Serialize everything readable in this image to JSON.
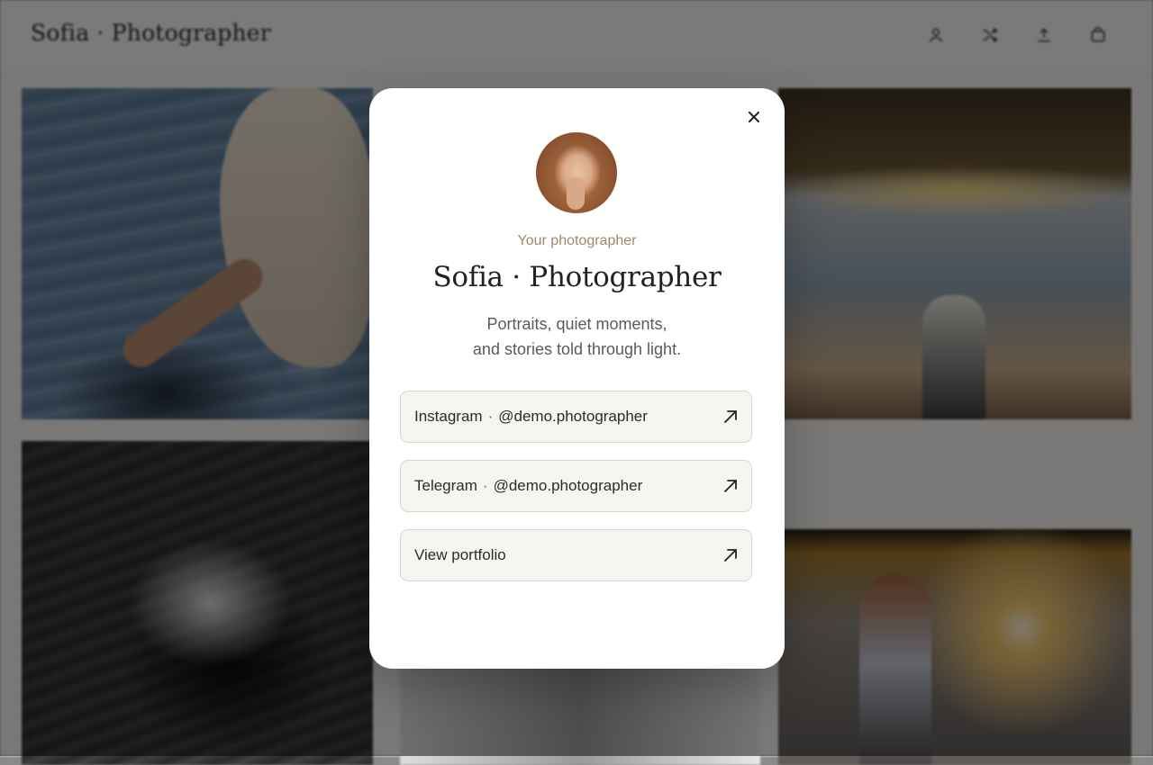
{
  "header": {
    "brand": "Sofia · Photographer",
    "icons": [
      "user-icon",
      "shuffle-icon",
      "upload-icon",
      "bag-icon"
    ]
  },
  "modal": {
    "eyebrow": "Your photographer",
    "title": "Sofia · Photographer",
    "description_lines": [
      "Portraits, quiet moments,",
      "and stories told through light."
    ],
    "links": [
      {
        "platform": "Instagram",
        "separator": "·",
        "handle": "@demo.photographer",
        "icon": "arrow-up-right-icon"
      },
      {
        "platform": "Telegram",
        "separator": "·",
        "handle": "@demo.photographer",
        "icon": "arrow-up-right-icon"
      },
      {
        "label": "View portfolio",
        "icon": "arrow-up-right-icon"
      }
    ],
    "close_icon": "close-icon"
  },
  "colors": {
    "eyebrow": "#9d8a6a",
    "card_bg": "#f6f5f1",
    "card_border": "#dcd7cc",
    "overlay": "rgba(0,0,0,0.50)"
  }
}
